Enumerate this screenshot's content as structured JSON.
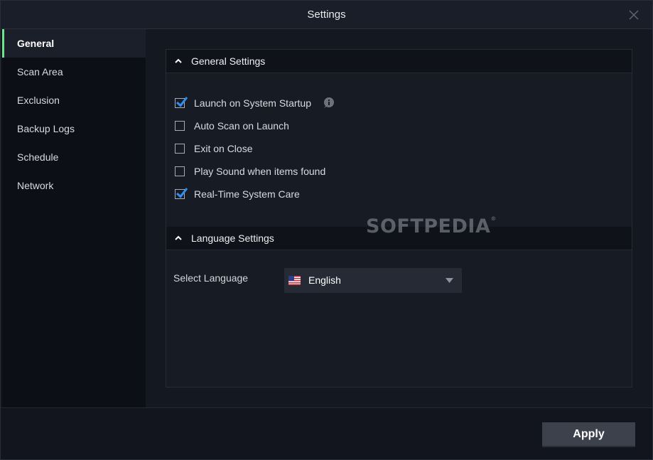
{
  "window": {
    "title": "Settings"
  },
  "sidebar": {
    "items": [
      {
        "label": "General",
        "active": true
      },
      {
        "label": "Scan Area",
        "active": false
      },
      {
        "label": "Exclusion",
        "active": false
      },
      {
        "label": "Backup Logs",
        "active": false
      },
      {
        "label": "Schedule",
        "active": false
      },
      {
        "label": "Network",
        "active": false
      }
    ]
  },
  "general_settings": {
    "title": "General Settings",
    "options": [
      {
        "label": "Launch on System Startup",
        "checked": true,
        "info_icon": "info-icon"
      },
      {
        "label": "Auto Scan on Launch",
        "checked": false
      },
      {
        "label": "Exit on Close",
        "checked": false
      },
      {
        "label": "Play Sound when items found",
        "checked": false
      },
      {
        "label": "Real-Time System Care",
        "checked": true
      }
    ]
  },
  "language_settings": {
    "title": "Language Settings",
    "select_label": "Select Language",
    "selected_language": "English",
    "flag_icon": "us-flag-icon"
  },
  "footer": {
    "apply_label": "Apply"
  },
  "watermark": {
    "text": "SOFTPEDIA",
    "mark": "®"
  },
  "colors": {
    "accent_active": "#6ee58a",
    "checkmark": "#2f8ff0",
    "background": "#12151d",
    "apply_button": "#3c414c"
  }
}
